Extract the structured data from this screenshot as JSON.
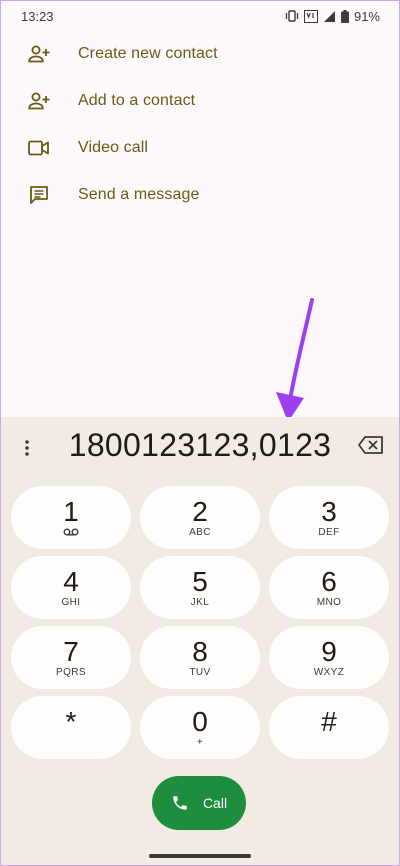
{
  "status": {
    "time": "13:23",
    "battery": "91%"
  },
  "actions": [
    {
      "label": "Create new contact",
      "icon": "add-person-icon"
    },
    {
      "label": "Add to a contact",
      "icon": "add-person-icon"
    },
    {
      "label": "Video call",
      "icon": "video-camera-icon"
    },
    {
      "label": "Send a message",
      "icon": "message-icon"
    }
  ],
  "dialer": {
    "number": "1800123123,0123",
    "keys": [
      {
        "digit": "1",
        "sub": ""
      },
      {
        "digit": "2",
        "sub": "ABC"
      },
      {
        "digit": "3",
        "sub": "DEF"
      },
      {
        "digit": "4",
        "sub": "GHI"
      },
      {
        "digit": "5",
        "sub": "JKL"
      },
      {
        "digit": "6",
        "sub": "MNO"
      },
      {
        "digit": "7",
        "sub": "PQRS"
      },
      {
        "digit": "8",
        "sub": "TUV"
      },
      {
        "digit": "9",
        "sub": "WXYZ"
      },
      {
        "digit": "*",
        "sub": ""
      },
      {
        "digit": "0",
        "sub": "+"
      },
      {
        "digit": "#",
        "sub": ""
      }
    ],
    "call_label": "Call"
  },
  "colors": {
    "accent": "#6d5a12",
    "call_green": "#1e8e3e",
    "panel_bg": "#f1ebe4",
    "arrow": "#9b3ff0"
  }
}
